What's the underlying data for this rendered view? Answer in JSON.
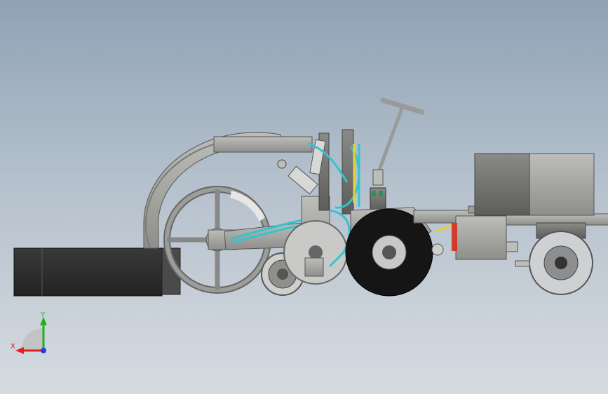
{
  "viewport": {
    "background_top": "#8fa2b5",
    "background_bottom": "#d6dbe1"
  },
  "model": {
    "part_color": "#a9a9a6",
    "part_dark": "#6e6e6c",
    "rubber_color": "#1a1a1a",
    "hose_cyan": "#32c4cf",
    "hose_yellow": "#e2d33a",
    "accent_red": "#d23a2a"
  },
  "triad": {
    "x_label": "X",
    "y_label": "Y",
    "x_color": "#e02020",
    "y_color": "#20b020",
    "z_color": "#2040e0",
    "icon": "coordinate-triad-icon"
  }
}
